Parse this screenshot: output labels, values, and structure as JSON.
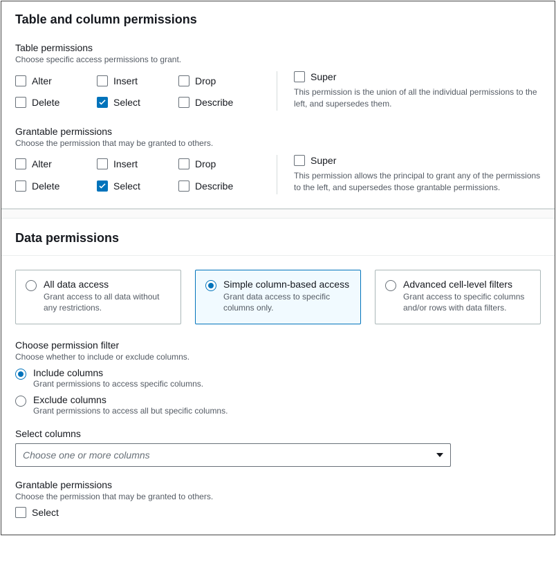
{
  "tableColumnSection": {
    "title": "Table and column permissions",
    "tablePermissions": {
      "title": "Table permissions",
      "desc": "Choose specific access permissions to grant.",
      "items": {
        "alter": "Alter",
        "insert": "Insert",
        "drop": "Drop",
        "delete": "Delete",
        "select": "Select",
        "describe": "Describe"
      },
      "super": {
        "label": "Super",
        "desc": "This permission is the union of all the individual permissions to the left, and supersedes them."
      }
    },
    "grantablePermissions": {
      "title": "Grantable permissions",
      "desc": "Choose the permission that may be granted to others.",
      "items": {
        "alter": "Alter",
        "insert": "Insert",
        "drop": "Drop",
        "delete": "Delete",
        "select": "Select",
        "describe": "Describe"
      },
      "super": {
        "label": "Super",
        "desc": "This permission allows the principal to grant any of the permissions to the left, and supersedes those grantable permissions."
      }
    }
  },
  "dataSection": {
    "title": "Data permissions",
    "accessTiles": {
      "all": {
        "title": "All data access",
        "desc": "Grant access to all data without any restrictions."
      },
      "simple": {
        "title": "Simple column-based access",
        "desc": "Grant data access to specific columns only."
      },
      "advanced": {
        "title": "Advanced cell-level filters",
        "desc": "Grant access to specific columns and/or rows with data filters."
      }
    },
    "filter": {
      "title": "Choose permission filter",
      "desc": "Choose whether to include or exclude columns.",
      "include": {
        "label": "Include columns",
        "desc": "Grant permissions to access specific columns."
      },
      "exclude": {
        "label": "Exclude columns",
        "desc": "Grant permissions to access all but specific columns."
      }
    },
    "selectColumns": {
      "title": "Select columns",
      "placeholder": "Choose one or more columns"
    },
    "grantable": {
      "title": "Grantable permissions",
      "desc": "Choose the permission that may be granted to others.",
      "select": "Select"
    }
  }
}
